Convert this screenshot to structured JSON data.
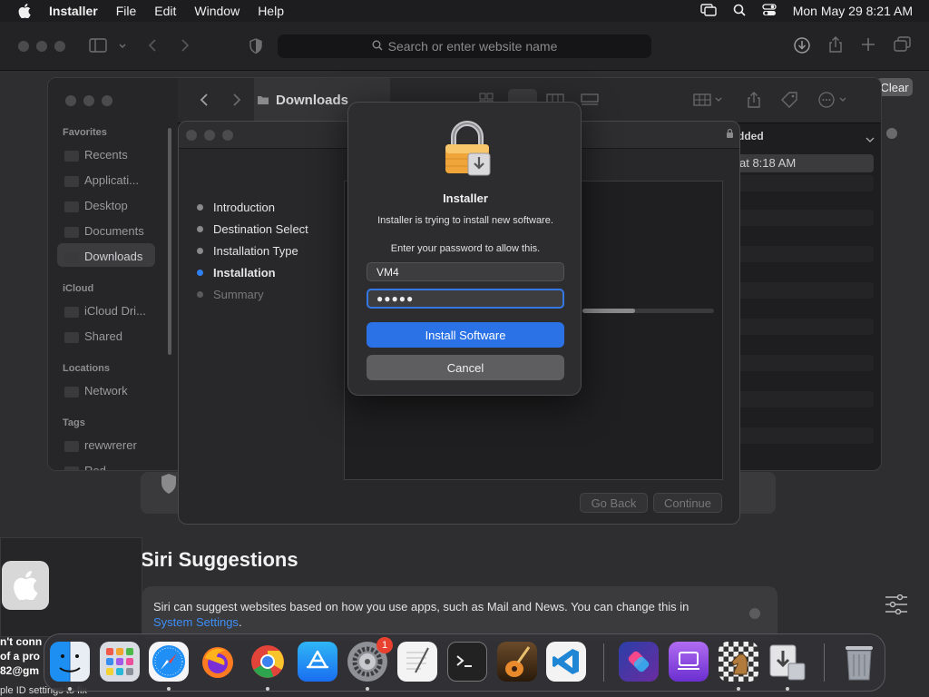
{
  "menubar": {
    "app_name": "Installer",
    "items": [
      "File",
      "Edit",
      "Window",
      "Help"
    ],
    "clock": "Mon May 29  8:21 AM"
  },
  "safari": {
    "search_placeholder": "Search or enter website name",
    "clear_label": "Clear",
    "siri_title": "Siri Suggestions",
    "siri_text": "Siri can suggest websites based on how you use apps, such as Mail and News. You can change this in",
    "siri_link": "System Settings",
    "siri_link_suffix": ".",
    "left_text_lines": [
      "n't conn",
      "of a pro",
      "82@gm"
    ],
    "left_bottom_text": "ple ID settings to fix"
  },
  "finder": {
    "title": "Downloads",
    "sidebar": {
      "favorites_label": "Favorites",
      "favorites": [
        "Recents",
        "Applicati...",
        "Desktop",
        "Documents",
        "Downloads"
      ],
      "icloud_label": "iCloud",
      "icloud": [
        "iCloud Dri...",
        "Shared"
      ],
      "locations_label": "Locations",
      "locations": [
        "Network"
      ],
      "tags_label": "Tags",
      "tags": [
        "rewwrerer",
        "Red"
      ]
    },
    "column_header": "dded",
    "selected_row_text": "at 8:18 AM"
  },
  "installer": {
    "steps": [
      {
        "label": "Introduction",
        "state": "done"
      },
      {
        "label": "Destination Select",
        "state": "done"
      },
      {
        "label": "Installation Type",
        "state": "done"
      },
      {
        "label": "Installation",
        "state": "active"
      },
      {
        "label": "Summary",
        "state": "pending"
      }
    ],
    "progress": 0.4,
    "go_back_label": "Go Back",
    "continue_label": "Continue"
  },
  "auth_dialog": {
    "title": "Installer",
    "message": "Installer is trying to install new software.",
    "prompt": "Enter your password to allow this.",
    "username": "VM4",
    "password_mask": "●●●●●",
    "install_label": "Install Software",
    "cancel_label": "Cancel"
  },
  "dock": {
    "apps": [
      "Finder",
      "Launchpad",
      "Safari",
      "Firefox",
      "Chrome",
      "App Store",
      "System Settings",
      "TextEdit",
      "Terminal",
      "GarageBand",
      "Visual Studio Code",
      "Shortcuts",
      "Apple Configurator",
      "Chess",
      "Installer",
      "Trash"
    ],
    "settings_badge": "1"
  },
  "colors": {
    "accent": "#2a72e6",
    "badge": "#e8412f",
    "link": "#3d8ef7"
  }
}
